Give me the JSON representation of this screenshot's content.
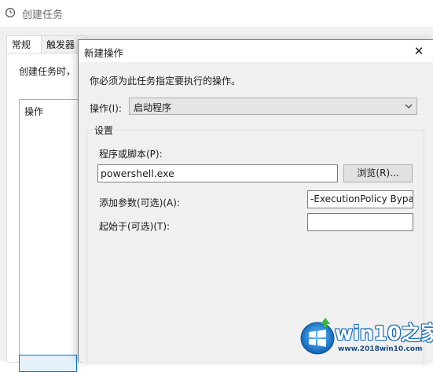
{
  "background_window": {
    "title": "创建任务",
    "tabs": [
      "常规",
      "触发器"
    ],
    "hint": "创建任务时，",
    "list_header": "操作"
  },
  "dialog": {
    "title": "新建操作",
    "close_label": "✕",
    "instruction": "你必须为此任务指定要执行的操作。",
    "action_label": "操作(I):",
    "action_value": "启动程序",
    "group_label": "设置",
    "program_label": "程序或脚本(P):",
    "program_value": "powershell.exe",
    "browse_label": "浏览(R)...",
    "args_label": "添加参数(可选)(A):",
    "args_value": "-ExecutionPolicy Bypass",
    "start_in_label": "起始于(可选)(T):",
    "start_in_value": ""
  },
  "watermark": {
    "brand": "win10之家",
    "url": "www.2018win10.com"
  },
  "colors": {
    "accent": "#0078d7",
    "dialog_bg": "#f0f0f0",
    "watermark_blue": "#1468b8"
  }
}
